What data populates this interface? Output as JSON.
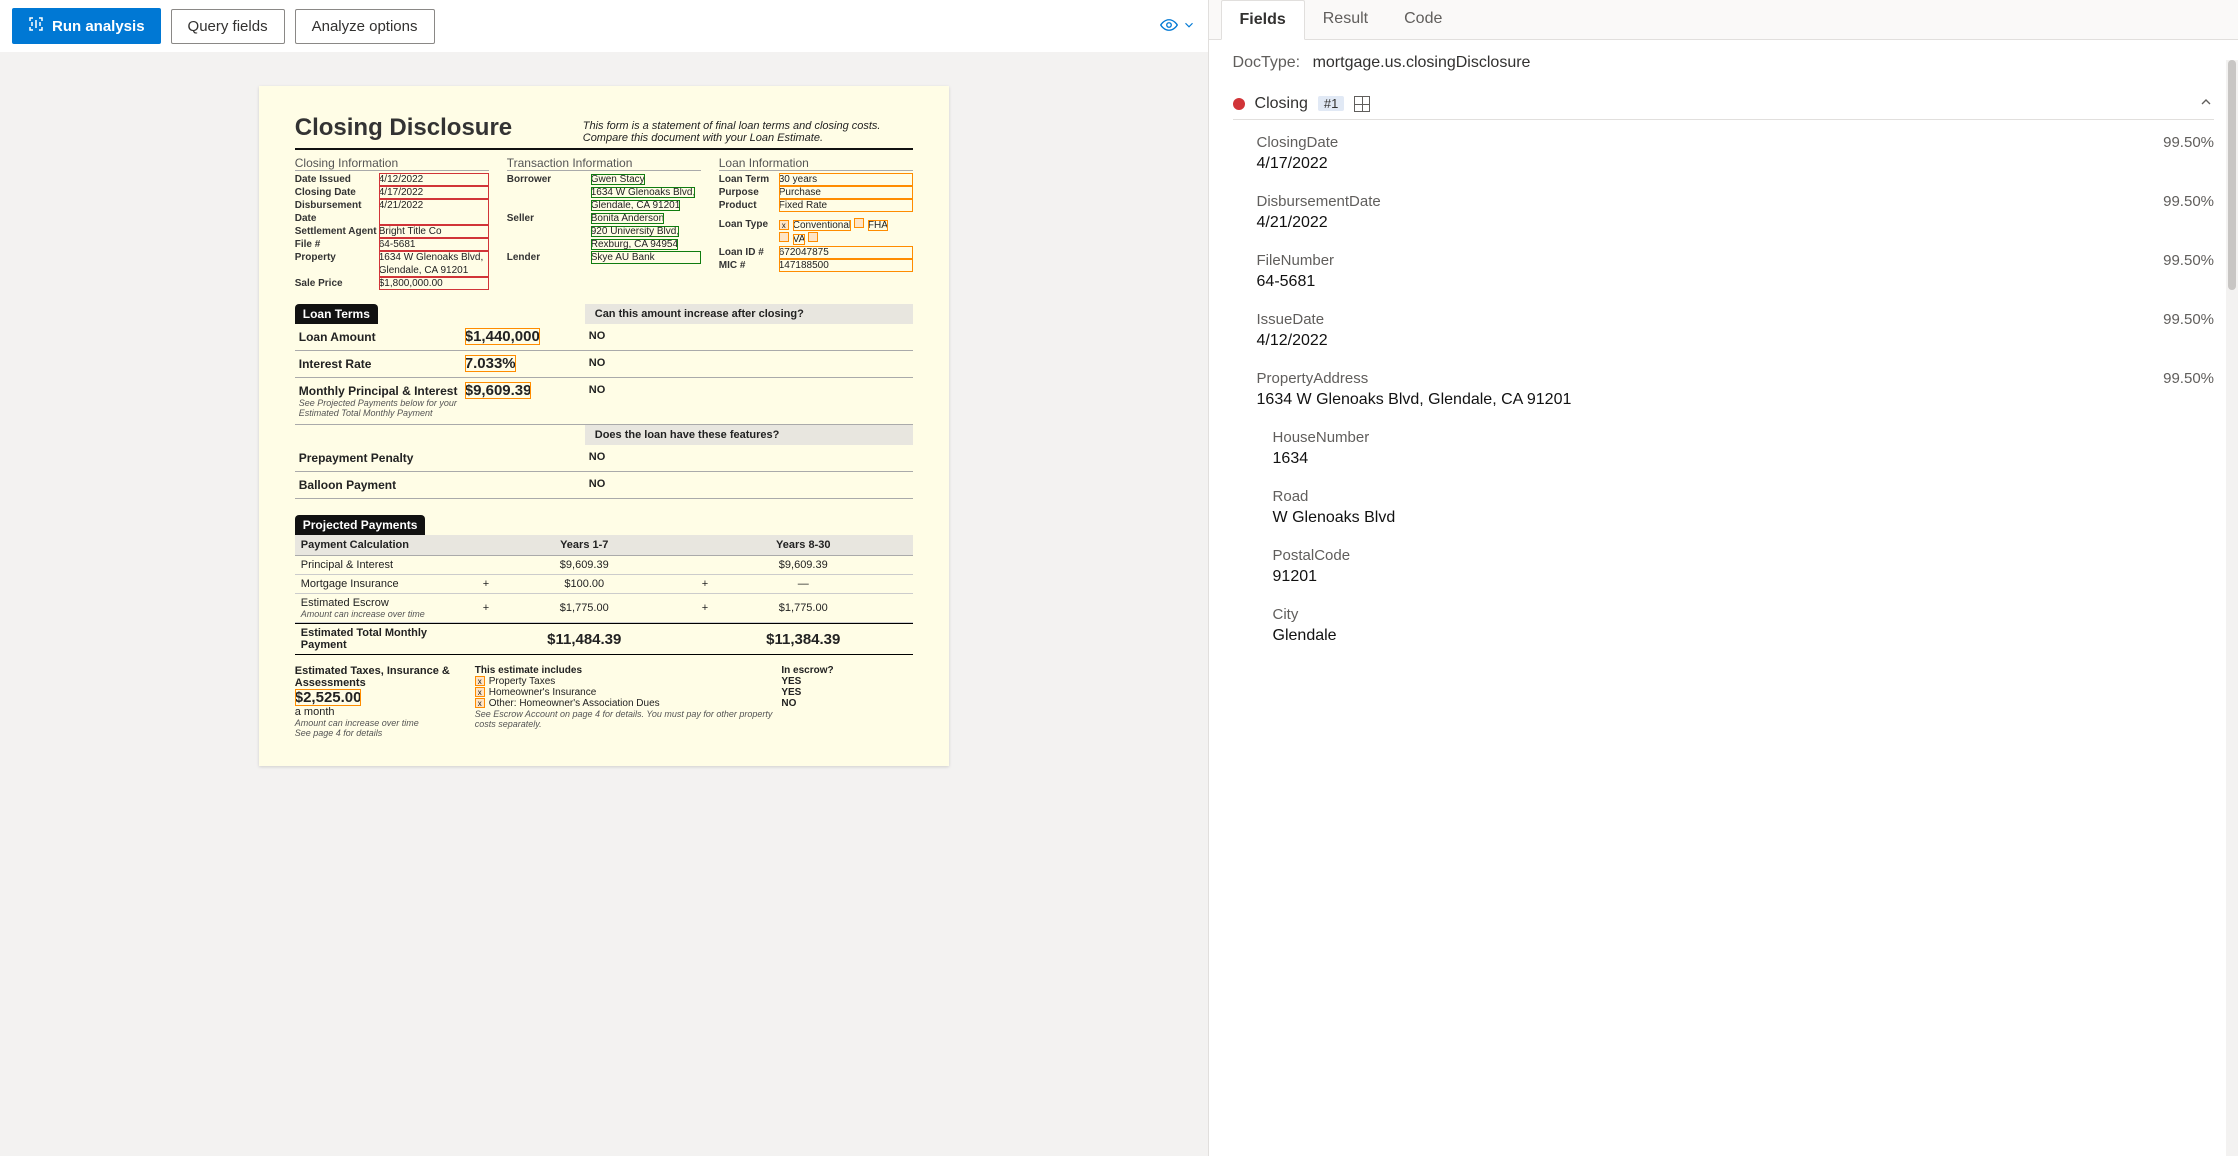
{
  "toolbar": {
    "run": "Run analysis",
    "query": "Query fields",
    "analyze": "Analyze options"
  },
  "document": {
    "title": "Closing Disclosure",
    "header_note": "This form is a statement of final loan terms and closing costs. Compare this document with your Loan Estimate.",
    "closing_info": {
      "heading": "Closing  Information",
      "date_issued_label": "Date Issued",
      "date_issued": "4/12/2022",
      "closing_date_label": "Closing Date",
      "closing_date": "4/17/2022",
      "disbursement_date_label": "Disbursement Date",
      "disbursement_date": "4/21/2022",
      "settlement_agent_label": "Settlement Agent",
      "settlement_agent": "Bright Title Co",
      "file_no_label": "File #",
      "file_no": "64-5681",
      "property_label": "Property",
      "property": "1634 W Glenoaks Blvd, Glendale, CA 91201",
      "sale_price_label": "Sale Price",
      "sale_price": "$1,800,000.00"
    },
    "transaction_info": {
      "heading": "Transaction  Information",
      "borrower_label": "Borrower",
      "borrower_name": "Gwen Stacy",
      "borrower_addr": "1634 W Glenoaks Blvd, Glendale, CA 91201",
      "seller_label": "Seller",
      "seller_name": "Bonita Anderson",
      "seller_addr": "920 University Blvd, Rexburg, CA 94954",
      "lender_label": "Lender",
      "lender": "Skye AU Bank"
    },
    "loan_info": {
      "heading": "Loan  Information",
      "loan_term_label": "Loan Term",
      "loan_term": "30 years",
      "purpose_label": "Purpose",
      "purpose": "Purchase",
      "product_label": "Product",
      "product": "Fixed Rate",
      "loan_type_label": "Loan Type",
      "loan_type_main": "Conventional",
      "loan_type_fha": "FHA",
      "loan_type_va": "VA",
      "loan_id_label": "Loan ID #",
      "loan_id": "672047875",
      "mic_label": "MIC #",
      "mic": "147188500"
    },
    "loan_terms": {
      "band": "Loan Terms",
      "question": "Can this amount increase after closing?",
      "loan_amount_label": "Loan Amount",
      "loan_amount": "$1,440,000",
      "loan_amount_ans": "NO",
      "interest_rate_label": "Interest Rate",
      "interest_rate": "7.033%",
      "interest_rate_ans": "NO",
      "mpi_label": "Monthly Principal & Interest",
      "mpi": "$9,609.39",
      "mpi_ans": "NO",
      "mpi_sub": "See Projected Payments below for your Estimated Total Monthly Payment",
      "features_q": "Does the loan have these features?",
      "prepay_label": "Prepayment Penalty",
      "prepay_ans": "NO",
      "balloon_label": "Balloon Payment",
      "balloon_ans": "NO"
    },
    "projected": {
      "band": "Projected Payments",
      "calc_label": "Payment Calculation",
      "years17": "Years 1-7",
      "years830": "Years 8-30",
      "pi_label": "Principal & Interest",
      "pi_17": "$9,609.39",
      "pi_830": "$9,609.39",
      "mi_label": "Mortgage Insurance",
      "mi_17": "$100.00",
      "mi_830": "—",
      "escrow_label": "Estimated Escrow",
      "escrow_sub": "Amount can increase over time",
      "escrow_17": "$1,775.00",
      "escrow_830": "$1,775.00",
      "est_total_label": "Estimated Total Monthly Payment",
      "est_17": "$11,484.39",
      "est_830": "$11,384.39",
      "est_taxes_label": "Estimated Taxes, Insurance & Assessments",
      "est_taxes_sub1": "Amount can increase over time",
      "est_taxes_sub2": "See page 4 for details",
      "est_amount": "$2,525.00",
      "a_month": "a month",
      "includes_head": "This estimate includes",
      "in_escrow_head": "In escrow?",
      "prop_taxes": "Property Taxes",
      "prop_taxes_escrow": "YES",
      "homeowners": "Homeowner's Insurance",
      "homeowners_escrow": "YES",
      "other": "Other: Homeowner's Association Dues",
      "other_escrow": "NO",
      "escrow_note": "See Escrow Account on page 4 for details. You must pay for other property costs separately."
    }
  },
  "results": {
    "tabs": {
      "fields": "Fields",
      "result": "Result",
      "code": "Code"
    },
    "doctype_label": "DocType:",
    "doctype": "mortgage.us.closingDisclosure",
    "section": {
      "name": "Closing",
      "badge": "#1"
    },
    "fields": [
      {
        "label": "ClosingDate",
        "value": "4/17/2022",
        "conf": "99.50%"
      },
      {
        "label": "DisbursementDate",
        "value": "4/21/2022",
        "conf": "99.50%"
      },
      {
        "label": "FileNumber",
        "value": "64-5681",
        "conf": "99.50%"
      },
      {
        "label": "IssueDate",
        "value": "4/12/2022",
        "conf": "99.50%"
      },
      {
        "label": "PropertyAddress",
        "value": "1634 W Glenoaks Blvd, Glendale, CA 91201",
        "conf": "99.50%"
      }
    ],
    "subfields": [
      {
        "label": "HouseNumber",
        "value": "1634"
      },
      {
        "label": "Road",
        "value": "W Glenoaks Blvd"
      },
      {
        "label": "PostalCode",
        "value": "91201"
      },
      {
        "label": "City",
        "value": "Glendale"
      }
    ]
  }
}
